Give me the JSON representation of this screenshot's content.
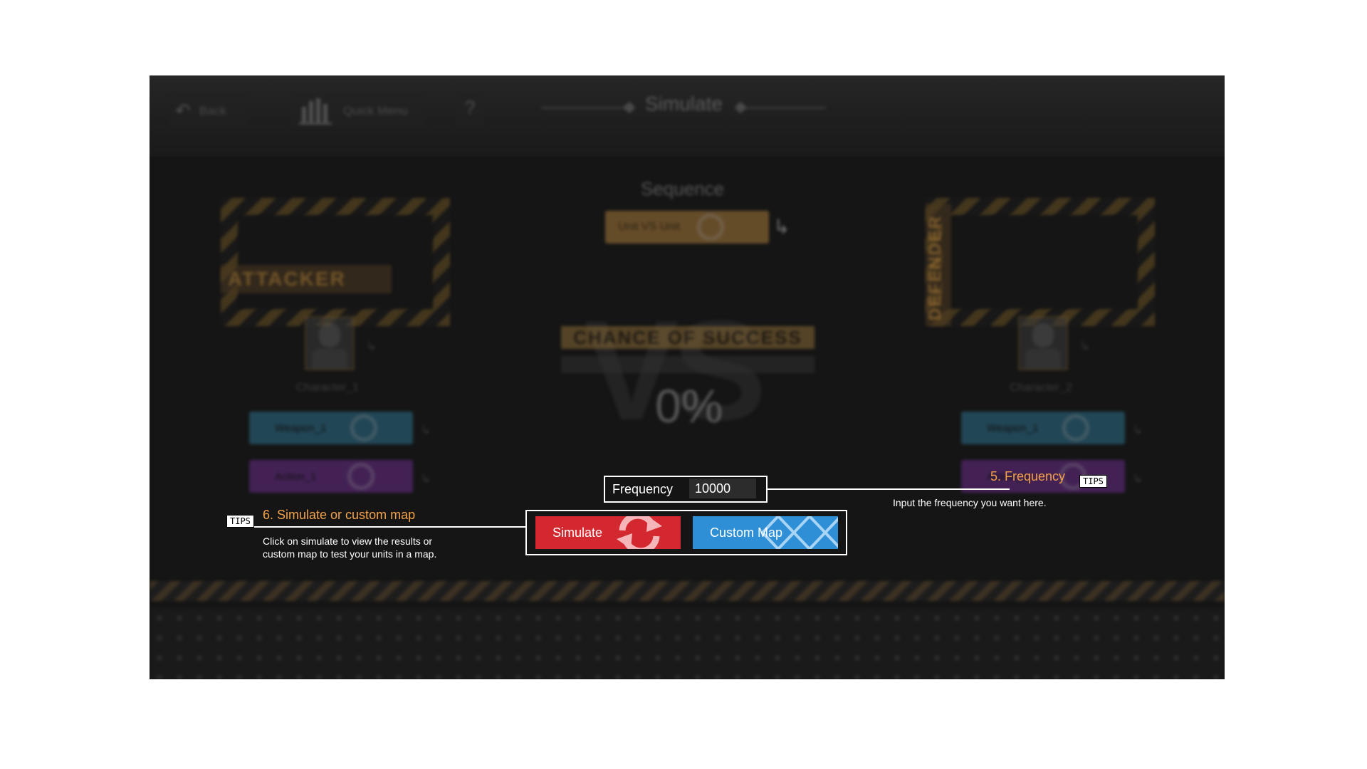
{
  "topbar": {
    "back_label": "Back",
    "quick_menu_label": "Quick Menu",
    "help_label": "?",
    "title": "Simulate"
  },
  "sequence": {
    "heading": "Sequence",
    "selector_label": "Unit VS Unit"
  },
  "attacker": {
    "badge": "ATTACKER",
    "character_name": "Character_1",
    "weapon_label": "Weapon_1",
    "action_label": "Action_1"
  },
  "defender": {
    "badge": "DEFENDER",
    "character_name": "Character_2",
    "weapon_label": "Weapon_1",
    "action_label": "Action_1"
  },
  "center": {
    "vs_text": "VS",
    "chance_heading": "CHANCE OF SUCCESS",
    "chance_value": "0%",
    "chance_progress": 0
  },
  "frequency": {
    "label": "Frequency",
    "value": "10000"
  },
  "buttons": {
    "simulate_label": "Simulate",
    "custom_map_label": "Custom Map"
  },
  "tips": {
    "badge": "TIPS",
    "frequency_title": "5. Frequency",
    "frequency_desc": "Input the frequency you want here.",
    "simulate_title": "6. Simulate or custom map",
    "simulate_desc_line1": "Click on simulate to view the results or",
    "simulate_desc_line2": "custom map to test your units in a map."
  },
  "colors": {
    "accent_gold": "#c9873a",
    "tip_orange": "#f2a14a",
    "simulate_red": "#d3282f",
    "custom_map_blue": "#2e8fd6",
    "weapon_blue": "#2c6f8c",
    "action_purple": "#6a2c8a"
  }
}
